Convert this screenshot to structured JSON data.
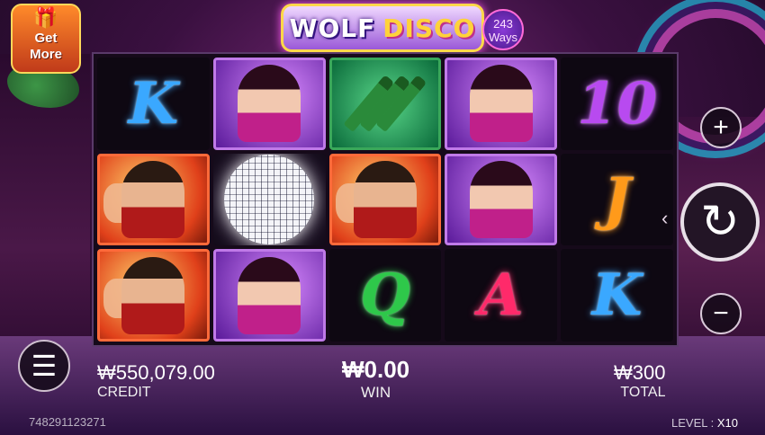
{
  "game": {
    "title_part1": "WOLF",
    "title_part2": "DISCO",
    "ways_badge": "243 Ways"
  },
  "get_more": {
    "label": "Get\nMore"
  },
  "reels": [
    [
      {
        "symbol": "K",
        "color": "#3aa8ff"
      },
      {
        "symbol": "man"
      },
      {
        "symbol": "man"
      }
    ],
    [
      {
        "symbol": "lady"
      },
      {
        "symbol": "disco-ball"
      },
      {
        "symbol": "lady"
      }
    ],
    [
      {
        "symbol": "bottles"
      },
      {
        "symbol": "man"
      },
      {
        "symbol": "Q",
        "color": "#2ec84a"
      }
    ],
    [
      {
        "symbol": "lady"
      },
      {
        "symbol": "lady"
      },
      {
        "symbol": "A",
        "color": "#ff2a6a"
      }
    ],
    [
      {
        "symbol": "10",
        "color": "#b84af0"
      },
      {
        "symbol": "J",
        "color": "#ff9a1a"
      },
      {
        "symbol": "K",
        "color": "#3aa8ff"
      }
    ]
  ],
  "controls": {
    "plus_icon": "+",
    "minus_icon": "−",
    "spin_icon": "↻",
    "chevron_icon": "‹",
    "menu_icon": "☰"
  },
  "credit": {
    "value": "₩550,079.00",
    "label": "CREDIT"
  },
  "win": {
    "value": "₩0.00",
    "label": "WIN"
  },
  "total": {
    "value": "₩300",
    "label": "TOTAL"
  },
  "round_id": "748291123271",
  "level": {
    "label": "LEVEL :",
    "value": "X10"
  }
}
